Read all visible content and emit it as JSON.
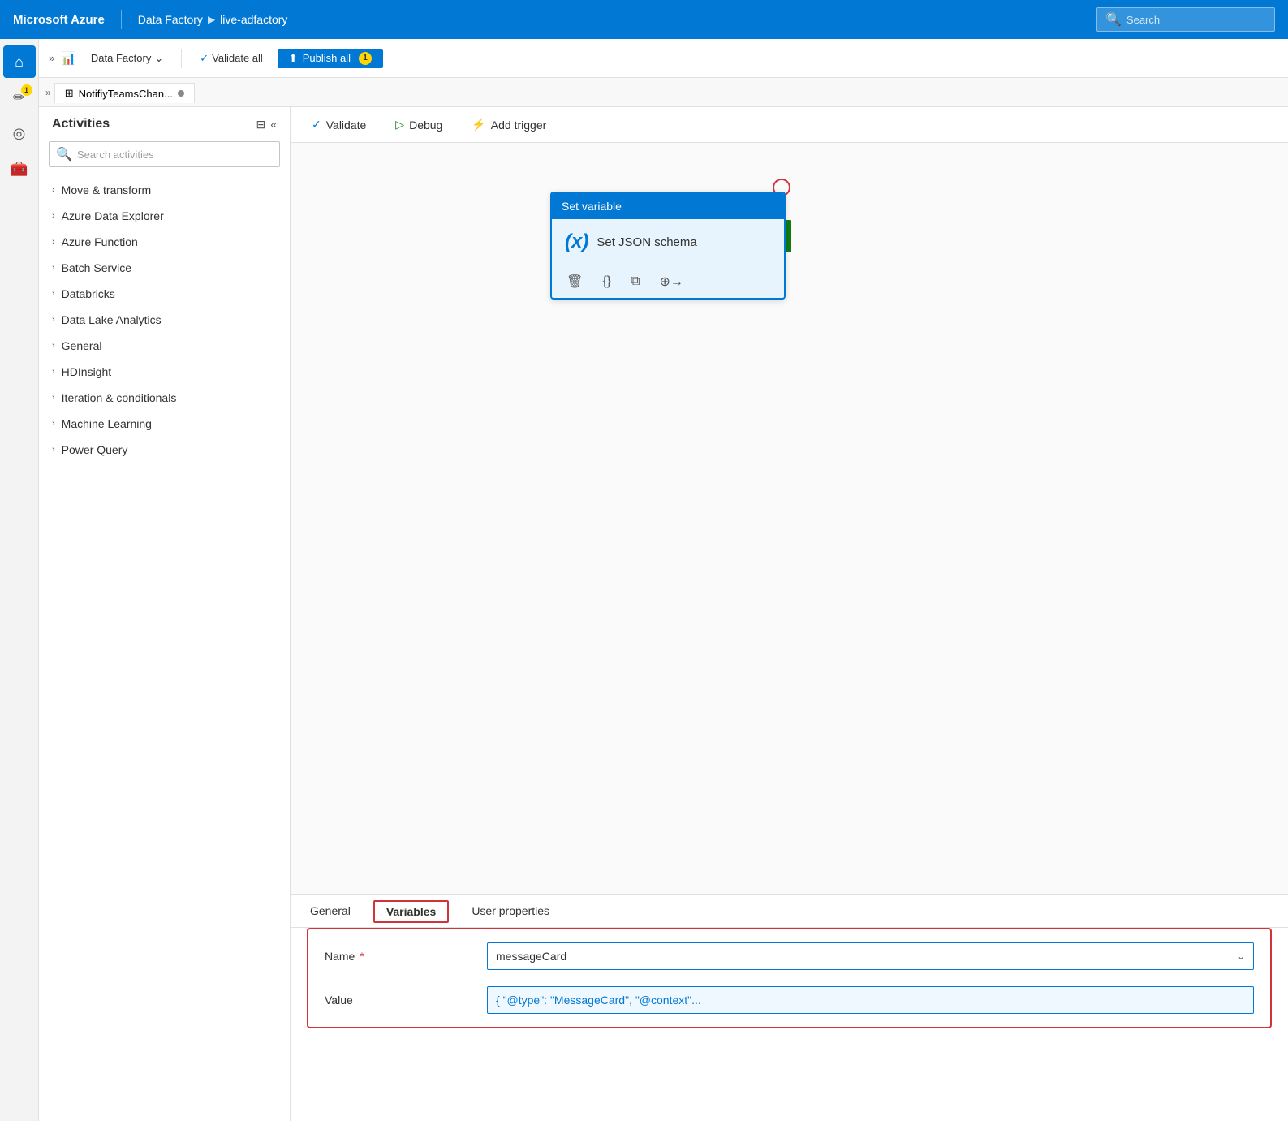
{
  "topnav": {
    "brand": "Microsoft Azure",
    "divider": "|",
    "service": "Data Factory",
    "chevron": "▶",
    "resource": "live-adfactory",
    "search_placeholder": "Search"
  },
  "toolbar": {
    "expand_label": "»",
    "df_icon": "📊",
    "df_label": "Data Factory",
    "validate_label": "Validate all",
    "publish_label": "Publish all",
    "publish_badge": "1"
  },
  "pipeline_tab": {
    "icon": "⊞",
    "label": "NotifiyTeamsChan...",
    "dot_visible": true
  },
  "pipeline_toolbar": {
    "validate_icon": "✓",
    "validate_label": "Validate",
    "debug_icon": "▷",
    "debug_label": "Debug",
    "trigger_icon": "⚡",
    "trigger_label": "Add trigger"
  },
  "activities": {
    "title": "Activities",
    "collapse_icon": "⊟",
    "collapse2_icon": "«",
    "search_placeholder": "Search activities",
    "groups": [
      {
        "label": "Move & transform"
      },
      {
        "label": "Azure Data Explorer"
      },
      {
        "label": "Azure Function"
      },
      {
        "label": "Batch Service"
      },
      {
        "label": "Databricks"
      },
      {
        "label": "Data Lake Analytics"
      },
      {
        "label": "General"
      },
      {
        "label": "HDInsight"
      },
      {
        "label": "Iteration & conditionals"
      },
      {
        "label": "Machine Learning"
      },
      {
        "label": "Power Query"
      }
    ]
  },
  "set_variable_card": {
    "header": "Set variable",
    "icon": "(x)",
    "label": "Set JSON schema",
    "footer_icons": [
      "🗑",
      "{}",
      "⧉",
      "⊕→"
    ]
  },
  "bottom_panel": {
    "tabs": [
      {
        "label": "General",
        "active": false
      },
      {
        "label": "Variables",
        "active": true
      },
      {
        "label": "User properties",
        "active": false
      }
    ],
    "form": {
      "name_label": "Name",
      "name_required": "*",
      "name_value": "messageCard",
      "name_chevron": "⌄",
      "value_label": "Value",
      "value_text": "{ \"@type\": \"MessageCard\", \"@context\"..."
    }
  },
  "icons": {
    "home": "⌂",
    "edit": "✏",
    "monitor": "◎",
    "manage": "🧰",
    "search": "🔍",
    "chevron_right": "›",
    "chevron_down": "⌄"
  }
}
